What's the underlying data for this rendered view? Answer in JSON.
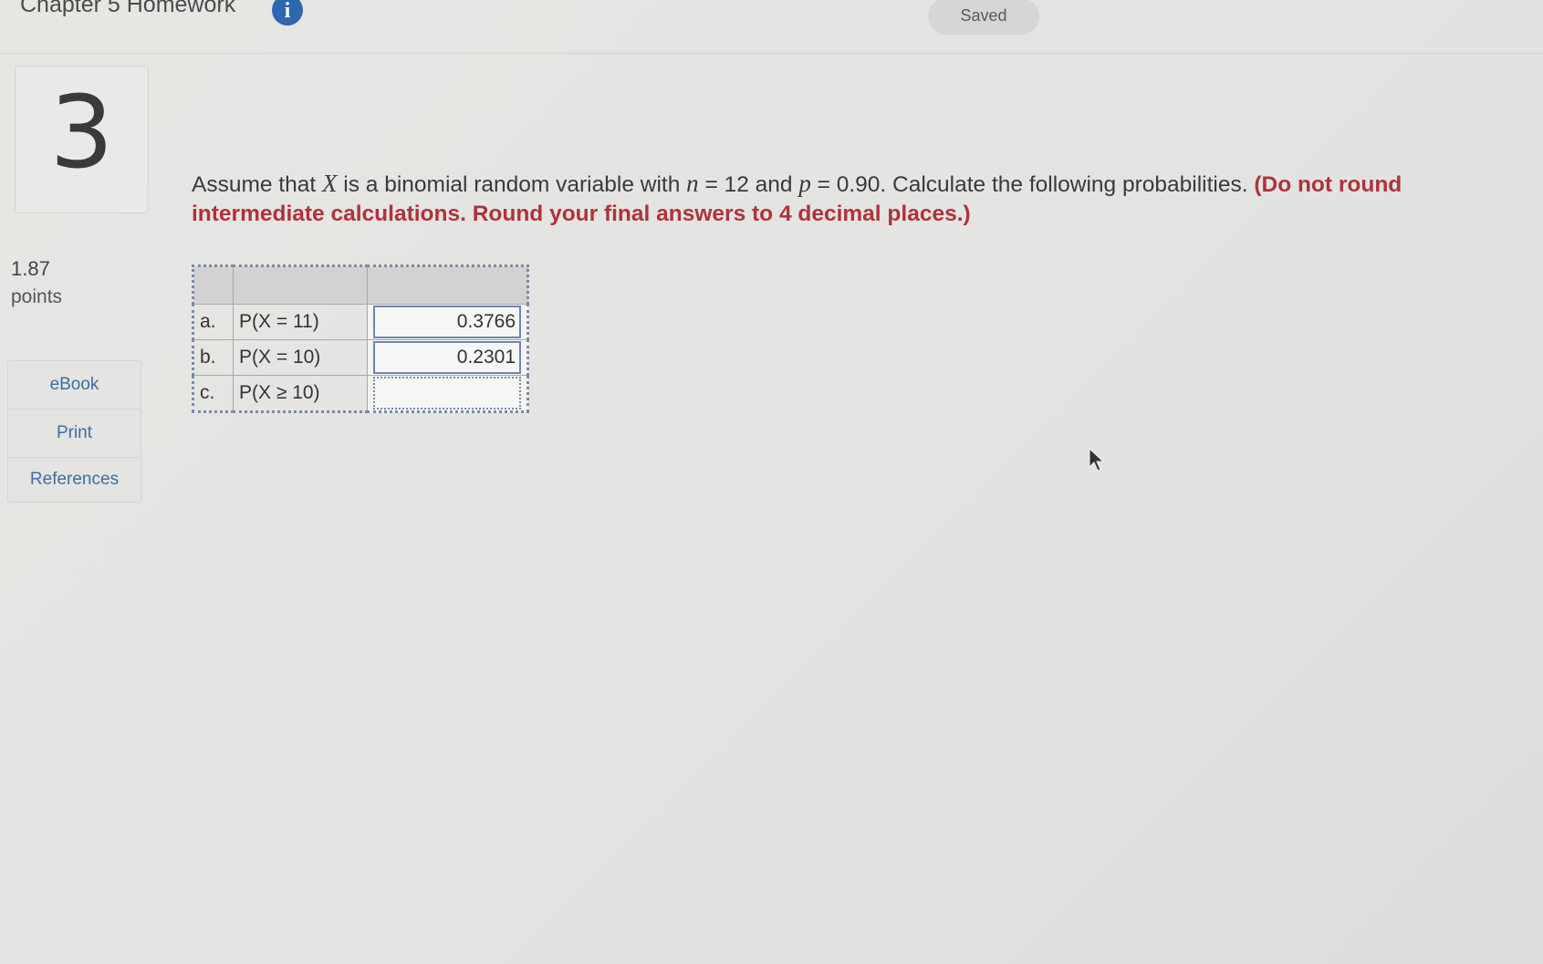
{
  "header": {
    "title": "Chapter 5 Homework",
    "info_icon": "info-icon",
    "saved_label": "Saved"
  },
  "question": {
    "number": "3",
    "points_value": "1.87",
    "points_label": "points",
    "text_part1": "Assume that ",
    "var_x": "X",
    "text_part2": " is a binomial random variable with ",
    "var_n": "n",
    "text_n_val": " = 12 and ",
    "var_p": "p",
    "text_p_val": " = 0.90. Calculate the following probabilities. ",
    "instruction_line1": "(Do not round",
    "instruction_line2": "intermediate calculations. Round your final answers to 4 decimal places.)"
  },
  "side_links": [
    "eBook",
    "Print",
    "References"
  ],
  "table": {
    "rows": [
      {
        "letter": "a.",
        "expr": "P(X = 11)",
        "answer": "0.3766"
      },
      {
        "letter": "b.",
        "expr": "P(X = 10)",
        "answer": "0.2301"
      },
      {
        "letter": "c.",
        "expr": "P(X ≥ 10)",
        "answer": ""
      }
    ]
  },
  "colors": {
    "instruction_red": "#b0323a",
    "link_blue": "#3e6ea3",
    "info_blue": "#2f66b0"
  }
}
